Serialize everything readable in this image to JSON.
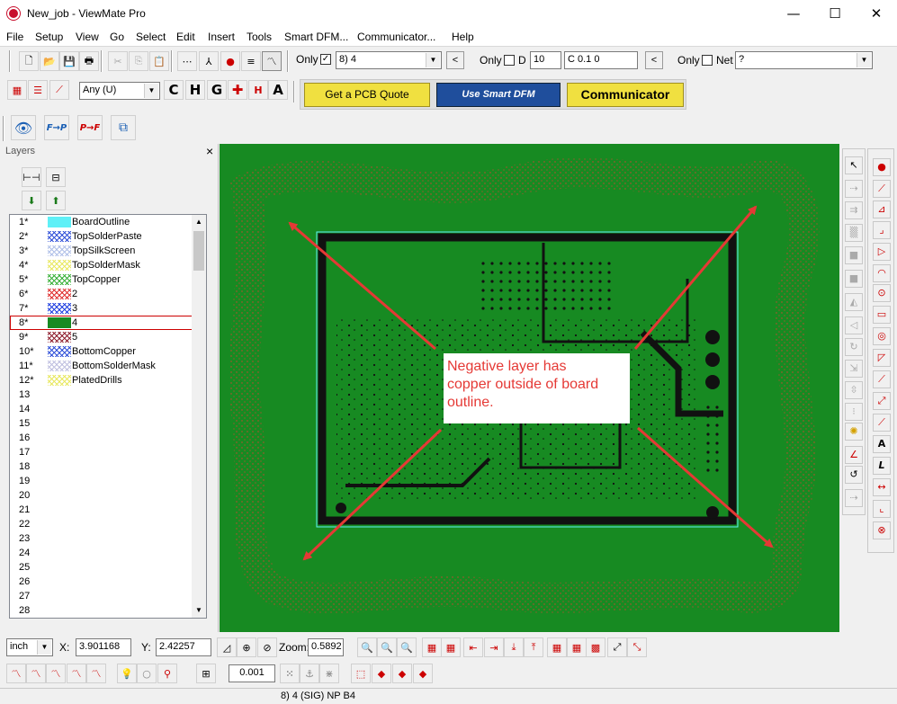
{
  "window": {
    "title": "New_job - ViewMate Pro",
    "minimize": "—",
    "maximize": "☐",
    "close": "✕"
  },
  "menu": [
    "File",
    "Setup",
    "View",
    "Go",
    "Select",
    "Edit",
    "Insert",
    "Tools",
    "Smart DFM...",
    "Communicator...",
    "Help"
  ],
  "toolbar1": {
    "only_label": "Only",
    "only_checked": "✓",
    "layer_select": "8) 4",
    "prev": "<",
    "only2_label": "Only",
    "d_label": "D",
    "d_value": "10",
    "coord_value": "C 0.1  0",
    "prev2": "<",
    "only3_label": "Only",
    "net_label": "Net",
    "net_value": "?"
  },
  "toolbar2": {
    "any_select": "Any   (U)",
    "quote_button": "Get a PCB Quote",
    "smart_dfm_button": "Use Smart DFM",
    "communicator_button": "Communicator"
  },
  "layers": {
    "title": "Layers",
    "close": "×",
    "rows": [
      {
        "num": "1*",
        "name": "BoardOutline",
        "color": "#5ff0f7",
        "pattern": "solid"
      },
      {
        "num": "2*",
        "name": "TopSolderPaste",
        "color": "#3050d8",
        "pattern": "hatch"
      },
      {
        "num": "3*",
        "name": "TopSilkScreen",
        "color": "#b0c0e8",
        "pattern": "hatch"
      },
      {
        "num": "4*",
        "name": "TopSolderMask",
        "color": "#e8e860",
        "pattern": "hatch"
      },
      {
        "num": "5*",
        "name": "TopCopper",
        "color": "#38b038",
        "pattern": "hatch"
      },
      {
        "num": "6*",
        "name": "2",
        "color": "#e03030",
        "pattern": "hatch"
      },
      {
        "num": "7*",
        "name": "3",
        "color": "#2040e0",
        "pattern": "hatch"
      },
      {
        "num": "8*",
        "name": "4",
        "color": "#178a22",
        "pattern": "solid"
      },
      {
        "num": "9*",
        "name": "5",
        "color": "#902030",
        "pattern": "hatch"
      },
      {
        "num": "10*",
        "name": "BottomCopper",
        "color": "#3050d8",
        "pattern": "hatch"
      },
      {
        "num": "11*",
        "name": "BottomSolderMask",
        "color": "#c0c0e0",
        "pattern": "hatch"
      },
      {
        "num": "12*",
        "name": "PlatedDrills",
        "color": "#e8e860",
        "pattern": "hatch"
      },
      {
        "num": "13",
        "name": ""
      },
      {
        "num": "14",
        "name": ""
      },
      {
        "num": "15",
        "name": ""
      },
      {
        "num": "16",
        "name": ""
      },
      {
        "num": "17",
        "name": ""
      },
      {
        "num": "18",
        "name": ""
      },
      {
        "num": "19",
        "name": ""
      },
      {
        "num": "20",
        "name": ""
      },
      {
        "num": "21",
        "name": ""
      },
      {
        "num": "22",
        "name": ""
      },
      {
        "num": "23",
        "name": ""
      },
      {
        "num": "24",
        "name": ""
      },
      {
        "num": "25",
        "name": ""
      },
      {
        "num": "26",
        "name": ""
      },
      {
        "num": "27",
        "name": ""
      },
      {
        "num": "28",
        "name": ""
      }
    ],
    "selected_index": 7
  },
  "canvas": {
    "board_color": "#178a22",
    "annotation_line1": "Negative layer has",
    "annotation_line2": "copper outside of board",
    "annotation_line3": "outline."
  },
  "bottom": {
    "unit_select": "inch",
    "x_label": "X:",
    "x_value": "3.901168",
    "y_label": "Y:",
    "y_value": "2.42257",
    "zoom_label": "Zoom:",
    "zoom_value": "0.5892",
    "grid_value": "0.001"
  },
  "status": {
    "text": "8) 4 (SIG) NP B4"
  }
}
